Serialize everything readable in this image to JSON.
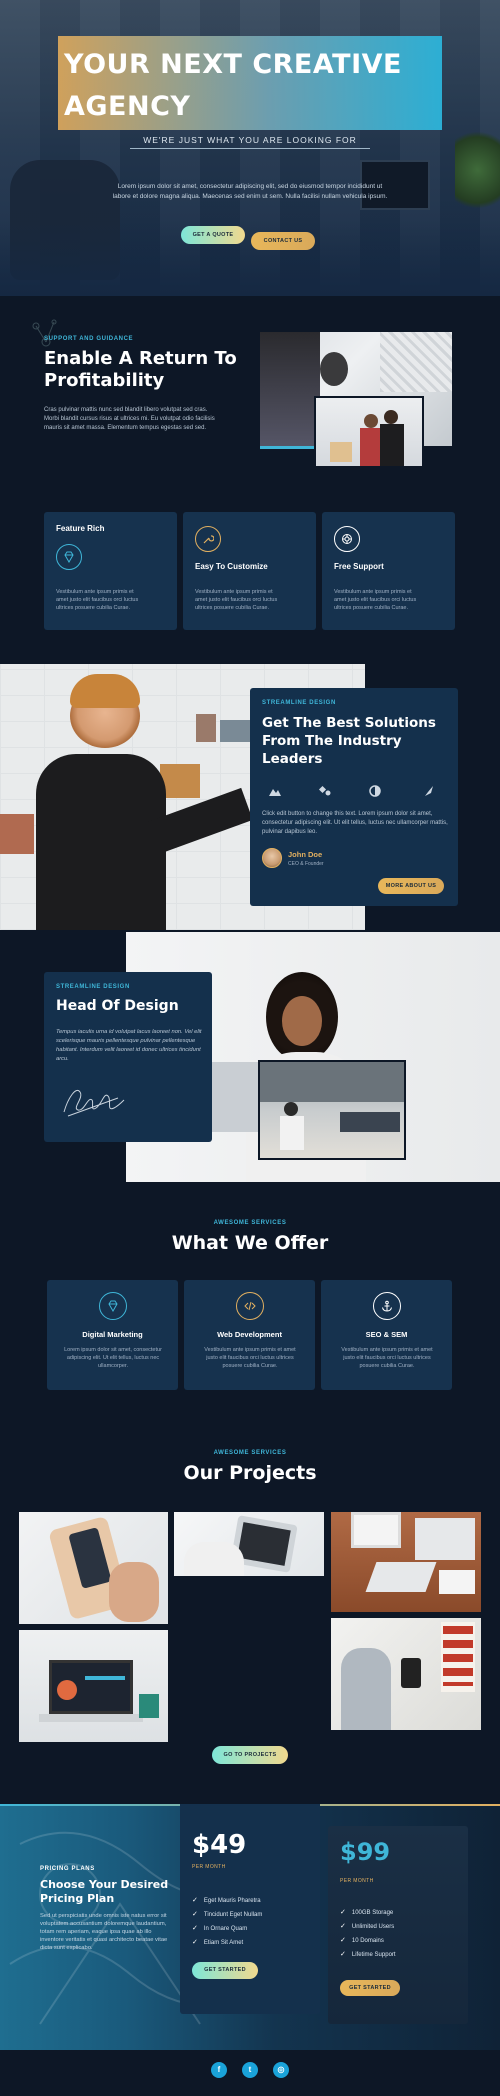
{
  "hero": {
    "title_line1": "YOUR NEXT CREATIVE",
    "title_line2": "AGENCY",
    "subtitle": "WE'RE JUST WHAT YOU ARE LOOKING FOR",
    "body": "Lorem ipsum dolor sit amet, consectetur adipiscing elit, sed do eiusmod tempor incididunt ut labore et dolore magna aliqua. Maecenas sed enim ut sem. Nulla facilisi nullam vehicula ipsum.",
    "btn_quote": "GET A QUOTE",
    "btn_contact": "CONTACT US"
  },
  "profit": {
    "eyebrow": "SUPPORT AND GUIDANCE",
    "title_line1": "Enable A Return To",
    "title_line2": "Profitability",
    "body": "Cras pulvinar mattis nunc sed blandit libero volutpat sed cras. Morbi blandit cursus risus at ultrices mi. Eu volutpat odio facilisis mauris sit amet massa. Elementum tempus egestas sed sed."
  },
  "features": [
    {
      "title": "Feature Rich",
      "icon": "diamond-icon",
      "text": "Vestibulum ante ipsum primis et amet justo elit faucibus orci luctus ultrices posuere cubilia Curae."
    },
    {
      "title": "Easy To Customize",
      "icon": "wrench-icon",
      "text": "Vestibulum ante ipsum primis et amet justo elit faucibus orci luctus ultrices posuere cubilia Curae."
    },
    {
      "title": "Free Support",
      "icon": "lifebuoy-icon",
      "text": "Vestibulum ante ipsum primis et amet justo elit faucibus orci luctus ultrices posuere cubilia Curae."
    }
  ],
  "solutions": {
    "eyebrow": "STREAMLINE DESIGN",
    "title_line1": "Get The Best Solutions",
    "title_line2": "From The Industry",
    "title_line3": "Leaders",
    "body": "Click edit button to change this text. Lorem ipsum dolor sit amet, consectetur adipiscing elit. Ut elit tellus, luctus nec ullamcorper mattis, pulvinar dapibus leo.",
    "person_name": "John Doe",
    "person_role": "CEO & Founder",
    "btn": "MORE ABOUT US"
  },
  "head_design": {
    "eyebrow": "STREAMLINE DESIGN",
    "title": "Head Of Design",
    "body": "Tempus iaculis urna id volutpat lacus laoreet non. Vel elit scelerisque mauris pellentesque pulvinar pellentesque habitant. Interdum velit laoreet id donec ultrices tincidunt arcu."
  },
  "offer": {
    "eyebrow": "AWESOME SERVICES",
    "title": "What We Offer",
    "items": [
      {
        "title": "Digital Marketing",
        "icon": "diamond-icon",
        "text": "Lorem ipsum dolor sit amet, consectetur adipiscing elit. Ut elit tellus, luctus nec ullamcorper."
      },
      {
        "title": "Web Development",
        "icon": "code-icon",
        "text": "Vestibulum ante ipsum primis et amet justo elit faucibus orci luctus ultrices posuere cubilia Curae."
      },
      {
        "title": "SEO & SEM",
        "icon": "anchor-icon",
        "text": "Vestibulum ante ipsum primis et amet justo elit faucibus orci luctus ultrices posuere cubilia Curae."
      }
    ]
  },
  "projects": {
    "eyebrow": "AWESOME SERVICES",
    "title": "Our Projects",
    "btn": "GO TO PROJECTS"
  },
  "pricing": {
    "eyebrow": "PRICING PLANS",
    "title_line1": "Choose Your Desired",
    "title_line2": "Pricing Plan",
    "body": "Sed ut perspiciatis unde omnis iste natus error sit voluptatem accusantium doloremque laudantium, totam rem aperiam, eaque ipsa quae ab illo inventore veritatis et quasi architecto beatae vitae dicta sunt explicabo.",
    "plan1": {
      "price": "$49",
      "period": "PER MONTH",
      "features": [
        "Eget Mauris Pharetra",
        "Tincidunt Eget Nullam",
        "In Ornare Quam",
        "Etiam Sit Amet"
      ],
      "btn": "GET STARTED"
    },
    "plan2": {
      "price": "$99",
      "period": "PER MONTH",
      "features": [
        "100GB Storage",
        "Unlimited Users",
        "10 Domains",
        "Lifetime Support"
      ],
      "btn": "GET STARTED"
    }
  },
  "footer": {
    "social": [
      {
        "icon": "facebook-icon",
        "glyph": "f"
      },
      {
        "icon": "twitter-icon",
        "glyph": "t"
      },
      {
        "icon": "instagram-icon",
        "glyph": "◎"
      }
    ]
  },
  "colors": {
    "accent_blue": "#3fb6d8",
    "accent_gold": "#e2b060",
    "bg": "#0d1726",
    "card": "#16324e"
  }
}
